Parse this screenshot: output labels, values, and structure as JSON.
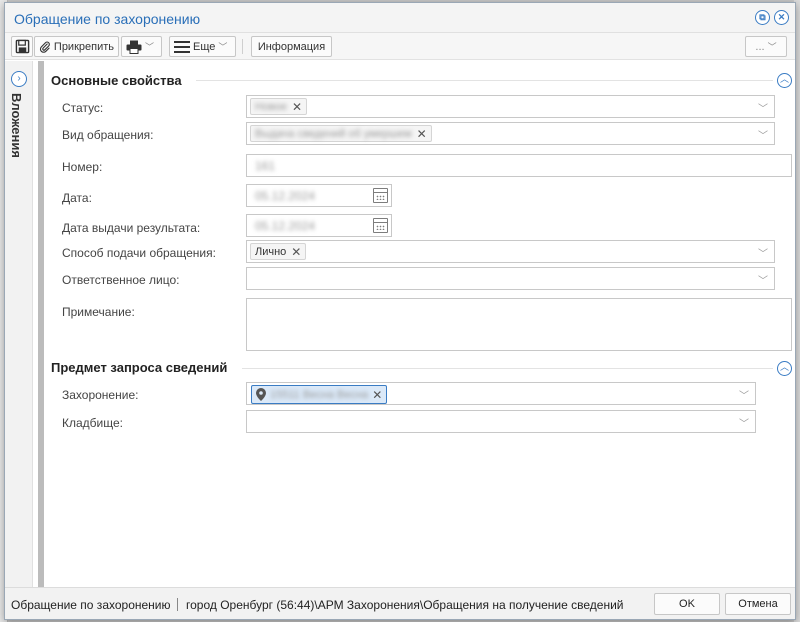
{
  "window": {
    "title": "Обращение по захоронению"
  },
  "toolbar": {
    "attach_label": "Прикрепить",
    "more_label": "Еще",
    "info_label": "Информация",
    "overflow_label": "..."
  },
  "side_tab": {
    "label": "Вложения"
  },
  "section_main": {
    "title": "Основные свойства",
    "status_label": "Статус:",
    "status_value": "Новое",
    "type_label": "Вид обращения:",
    "type_value": "Выдача сведений об умершем",
    "number_label": "Номер:",
    "number_value": "161",
    "date_label": "Дата:",
    "date_value": "05.12.2024",
    "result_date_label": "Дата выдачи результата:",
    "result_date_value": "05.12.2024",
    "method_label": "Способ подачи обращения:",
    "method_value": "Лично",
    "responsible_label": "Ответственное лицо:",
    "note_label": "Примечание:"
  },
  "section_request": {
    "title": "Предмет запроса сведений",
    "burial_label": "Захоронение:",
    "burial_value": "15511 Весна Весна",
    "cemetery_label": "Кладбище:"
  },
  "footer": {
    "doc_name": "Обращение по захоронению",
    "path": "город Оренбург (56:44)\\АРМ Захоронения\\Обращения на получение сведений",
    "ok_label": "OK",
    "cancel_label": "Отмена"
  },
  "colors": {
    "accent": "#3a7cc4",
    "title_text": "#2a6fb8"
  },
  "icons": [
    "save-icon",
    "paperclip-icon",
    "print-icon",
    "menu-icon",
    "collapse-up-icon",
    "location-pin-icon",
    "calendar-icon"
  ]
}
